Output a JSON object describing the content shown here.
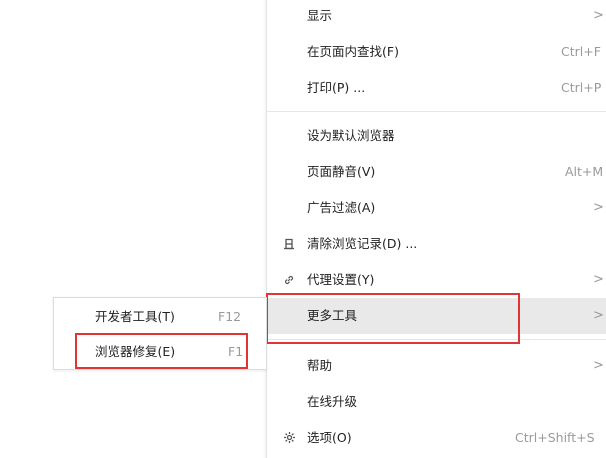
{
  "main_menu": {
    "items": [
      {
        "label": "显示",
        "shortcut": "",
        "arrow": ">",
        "icon": ""
      },
      {
        "label": "在页面内查找(F)",
        "shortcut": "Ctrl+F",
        "arrow": "",
        "icon": ""
      },
      {
        "label": "打印(P) ...",
        "shortcut": "Ctrl+P",
        "arrow": "",
        "icon": ""
      },
      {
        "label": "设为默认浏览器",
        "shortcut": "",
        "arrow": "",
        "icon": ""
      },
      {
        "label": "页面静音(V)",
        "shortcut": "Alt+M",
        "arrow": "",
        "icon": ""
      },
      {
        "label": "广告过滤(A)",
        "shortcut": "",
        "arrow": ">",
        "icon": ""
      },
      {
        "label": "清除浏览记录(D) ...",
        "shortcut": "",
        "arrow": "",
        "icon": "eraser-icon"
      },
      {
        "label": "代理设置(Y)",
        "shortcut": "",
        "arrow": ">",
        "icon": "link-icon"
      },
      {
        "label": "更多工具",
        "shortcut": "",
        "arrow": ">",
        "icon": ""
      },
      {
        "label": "帮助",
        "shortcut": "",
        "arrow": ">",
        "icon": ""
      },
      {
        "label": "在线升级",
        "shortcut": "",
        "arrow": "",
        "icon": ""
      },
      {
        "label": "选项(O)",
        "shortcut": "Ctrl+Shift+S",
        "arrow": "",
        "icon": "gear-icon"
      }
    ],
    "highlighted_item": "更多工具"
  },
  "sub_menu": {
    "items": [
      {
        "label": "开发者工具(T)",
        "shortcut": "F12"
      },
      {
        "label": "浏览器修复(E)",
        "shortcut": "F1"
      }
    ]
  },
  "icons": {
    "eraser_glyph": "🩹",
    "link_glyph": "⛓",
    "gear_glyph": "⚙"
  },
  "colors": {
    "highlight_bg": "#e9e9e9",
    "annotation_red": "#e23434",
    "shortcut_text": "#9a9a9a"
  }
}
